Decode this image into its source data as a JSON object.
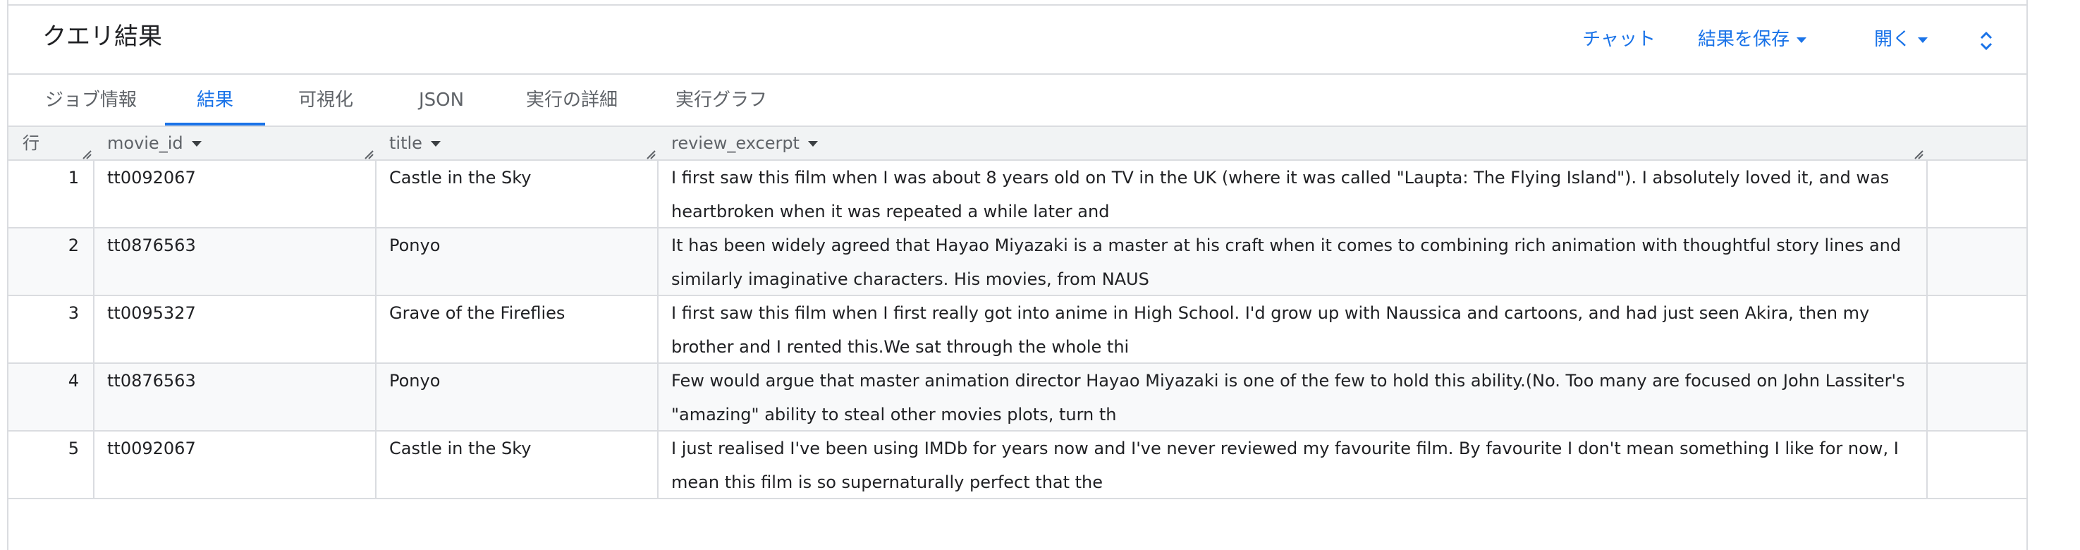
{
  "header": {
    "title": "クエリ結果",
    "actions": {
      "chat": "チャット",
      "save_results": "結果を保存",
      "open": "開く"
    }
  },
  "tabs": [
    {
      "label": "ジョブ情報",
      "active": false
    },
    {
      "label": "結果",
      "active": true
    },
    {
      "label": "可視化",
      "active": false
    },
    {
      "label": "JSON",
      "active": false
    },
    {
      "label": "実行の詳細",
      "active": false
    },
    {
      "label": "実行グラフ",
      "active": false
    }
  ],
  "table": {
    "columns": [
      "行",
      "movie_id",
      "title",
      "review_excerpt"
    ],
    "rows": [
      {
        "row": "1",
        "movie_id": "tt0092067",
        "title": "Castle in the Sky",
        "review_excerpt": "I first saw this film when I was about 8 years old on TV in the UK (where it was called \"Laupta: The Flying Island\"). I absolutely loved it, and was heartbroken when it was repeated a while later and"
      },
      {
        "row": "2",
        "movie_id": "tt0876563",
        "title": "Ponyo",
        "review_excerpt": "It has been widely agreed that Hayao Miyazaki is a master at his craft when it comes to combining rich animation with thoughtful story lines and similarly imaginative characters. His movies, from NAUS"
      },
      {
        "row": "3",
        "movie_id": "tt0095327",
        "title": "Grave of the Fireflies",
        "review_excerpt": "I first saw this film when I first really got into anime in High School. I'd grow up with Naussica and cartoons, and had just seen Akira, then my brother and I rented this.We sat through the whole thi"
      },
      {
        "row": "4",
        "movie_id": "tt0876563",
        "title": "Ponyo",
        "review_excerpt": "Few would argue that master animation director Hayao Miyazaki is one of the few to hold this ability.(No. Too many are focused on John Lassiter's \"amazing\" ability to steal other movies plots, turn th"
      },
      {
        "row": "5",
        "movie_id": "tt0092067",
        "title": "Castle in the Sky",
        "review_excerpt": "I just realised I've been using IMDb for years now and I've never reviewed my favourite film. By favourite I don't mean something I like for now, I mean this film is so supernaturally perfect that the"
      }
    ]
  },
  "colors": {
    "accent": "#1a73e8",
    "border": "#dadce0",
    "header_bg": "#f1f3f4",
    "alt_row_bg": "#f8f9fa"
  }
}
